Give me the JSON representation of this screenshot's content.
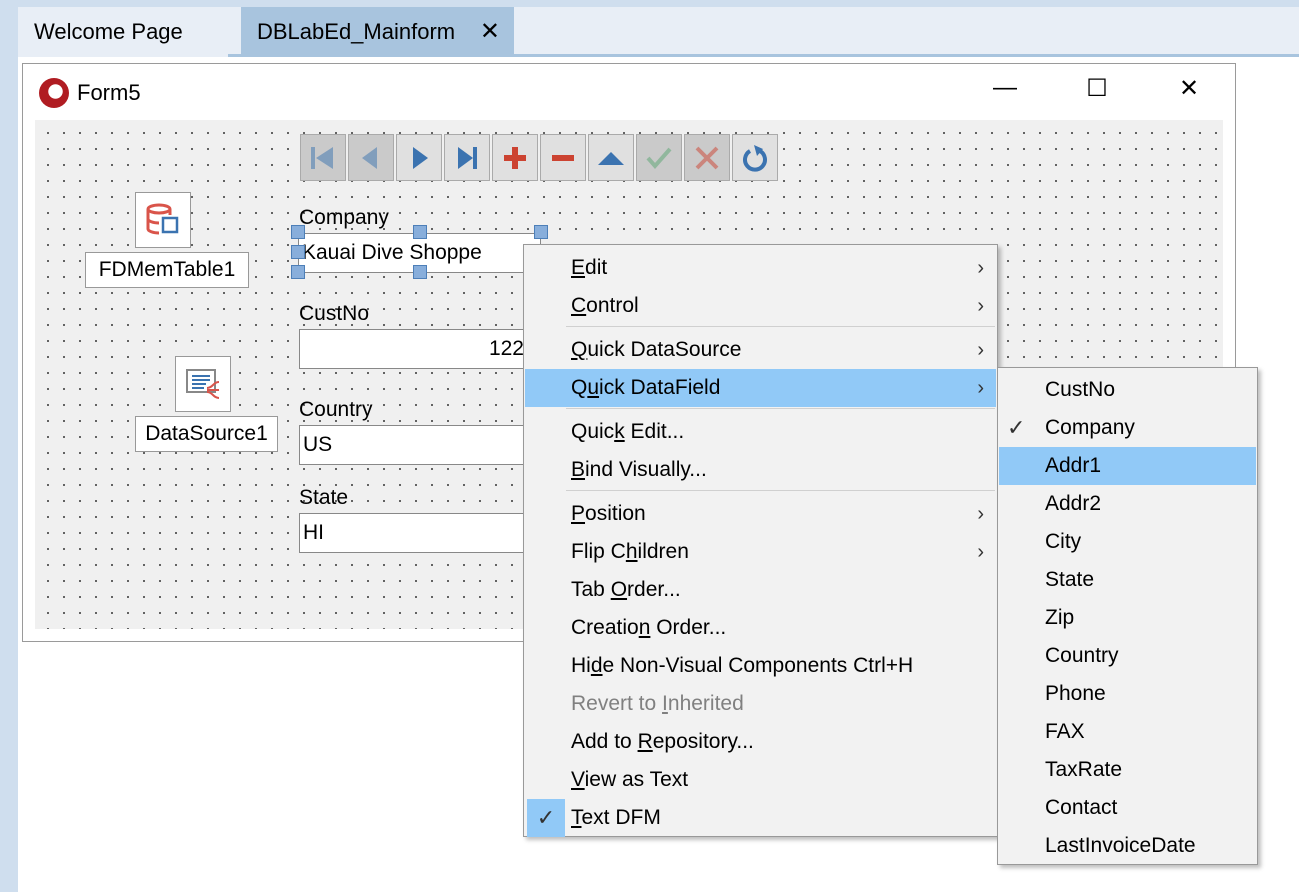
{
  "tabs": [
    {
      "label": "Welcome Page",
      "active": false
    },
    {
      "label": "DBLabEd_Mainform",
      "active": true,
      "close_icon": "close-icon"
    }
  ],
  "form": {
    "title": "Form5",
    "icon": "delphi-helmet-icon",
    "minimize": "—",
    "maximize": "☐",
    "close": "✕"
  },
  "navigator": {
    "buttons": [
      {
        "name": "first",
        "icon": "first-record-icon",
        "enabled": false
      },
      {
        "name": "prior",
        "icon": "prior-record-icon",
        "enabled": false
      },
      {
        "name": "next",
        "icon": "next-record-icon",
        "enabled": true
      },
      {
        "name": "last",
        "icon": "last-record-icon",
        "enabled": true
      },
      {
        "name": "insert",
        "icon": "plus-icon",
        "enabled": true
      },
      {
        "name": "delete",
        "icon": "minus-icon",
        "enabled": true
      },
      {
        "name": "edit",
        "icon": "triangle-up-icon",
        "enabled": true
      },
      {
        "name": "post",
        "icon": "check-icon",
        "enabled": false
      },
      {
        "name": "cancel",
        "icon": "x-icon",
        "enabled": false
      },
      {
        "name": "refresh",
        "icon": "refresh-icon",
        "enabled": true
      }
    ]
  },
  "components": {
    "memtable": "FDMemTable1",
    "datasource": "DataSource1"
  },
  "fields": {
    "company": {
      "label": "Company",
      "value": "Kauai Dive Shoppe"
    },
    "custno": {
      "label": "CustNo",
      "value": "122"
    },
    "country": {
      "label": "Country",
      "value": "US"
    },
    "state": {
      "label": "State",
      "value": "HI"
    }
  },
  "context_menu": {
    "items": [
      {
        "pre": "",
        "key": "E",
        "post": "dit",
        "submenu": true
      },
      {
        "pre": "",
        "key": "C",
        "post": "ontrol",
        "submenu": true
      },
      {
        "pre": "",
        "key": "Q",
        "post": "uick DataSource",
        "submenu": true
      },
      {
        "pre": "Q",
        "key": "u",
        "post": "ick DataField",
        "submenu": true,
        "highlighted": true
      },
      {
        "pre": "Quic",
        "key": "k",
        "post": " Edit...",
        "submenu": false
      },
      {
        "pre": "",
        "key": "B",
        "post": "ind Visually...",
        "submenu": false
      },
      {
        "pre": "",
        "key": "P",
        "post": "osition",
        "submenu": true
      },
      {
        "pre": "Flip C",
        "key": "h",
        "post": "ildren",
        "submenu": true
      },
      {
        "pre": "Tab ",
        "key": "O",
        "post": "rder...",
        "submenu": false
      },
      {
        "pre": "Creatio",
        "key": "n",
        "post": " Order...",
        "submenu": false
      },
      {
        "pre": "Hi",
        "key": "d",
        "post": "e Non-Visual Components Ctrl+H",
        "submenu": false
      },
      {
        "pre": "Revert to ",
        "key": "I",
        "post": "nherited",
        "submenu": false,
        "disabled": true
      },
      {
        "pre": "Add to ",
        "key": "R",
        "post": "epository...",
        "submenu": false
      },
      {
        "pre": "",
        "key": "V",
        "post": "iew as Text",
        "submenu": false
      },
      {
        "pre": "",
        "key": "T",
        "post": "ext DFM",
        "submenu": false,
        "checked": true
      }
    ]
  },
  "datafield_submenu": {
    "items": [
      "CustNo",
      "Company",
      "Addr1",
      "Addr2",
      "City",
      "State",
      "Zip",
      "Country",
      "Phone",
      "FAX",
      "TaxRate",
      "Contact",
      "LastInvoiceDate"
    ],
    "checked": "Company",
    "highlighted": "Addr1"
  },
  "colors": {
    "highlight": "#91c9f7",
    "active_tab": "#a8c4de",
    "nav_blue": "#3b73b0",
    "nav_red": "#cc4331"
  }
}
